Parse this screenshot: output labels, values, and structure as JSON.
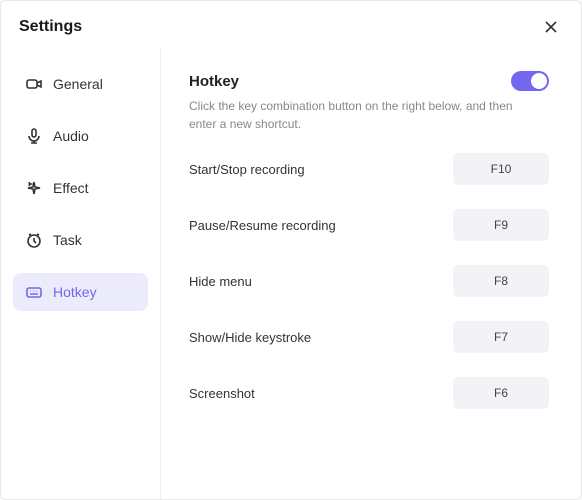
{
  "title": "Settings",
  "sidebar": {
    "items": [
      {
        "id": "general",
        "label": "General",
        "active": false
      },
      {
        "id": "audio",
        "label": "Audio",
        "active": false
      },
      {
        "id": "effect",
        "label": "Effect",
        "active": false
      },
      {
        "id": "task",
        "label": "Task",
        "active": false
      },
      {
        "id": "hotkey",
        "label": "Hotkey",
        "active": true
      }
    ]
  },
  "main": {
    "section_title": "Hotkey",
    "toggle_on": true,
    "description": "Click the key combination button on the right below, and then enter a new shortcut.",
    "rows": [
      {
        "label": "Start/Stop recording",
        "key": "F10"
      },
      {
        "label": "Pause/Resume recording",
        "key": "F9"
      },
      {
        "label": "Hide menu",
        "key": "F8"
      },
      {
        "label": "Show/Hide keystroke",
        "key": "F7"
      },
      {
        "label": "Screenshot",
        "key": "F6"
      }
    ]
  },
  "colors": {
    "accent": "#7367f0"
  }
}
